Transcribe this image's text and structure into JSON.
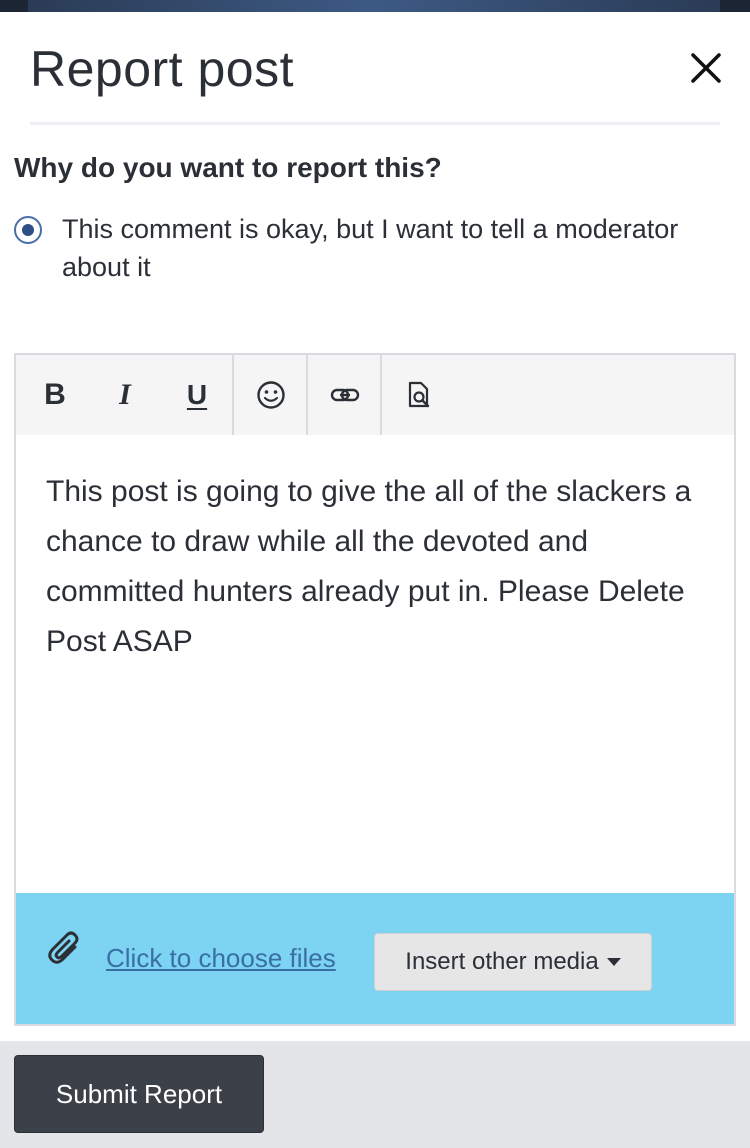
{
  "dialog": {
    "title": "Report post",
    "close_icon": "close-icon"
  },
  "question": "Why do you want to report this?",
  "reason_option": {
    "label": "This comment is okay, but I want to tell a moderator about it",
    "selected": true
  },
  "toolbar": {
    "bold_label": "B",
    "italic_label": "I",
    "underline_label": "U",
    "icons": [
      "emoji-icon",
      "link-icon",
      "preview-icon"
    ]
  },
  "editor": {
    "text": "This post is going to give the all of the slackers a chance to draw while all the devoted and committed hunters already put in. Please Delete Post ASAP"
  },
  "attachments": {
    "choose_files_label": "Click to choose files",
    "insert_media_label": "Insert other media",
    "background_color": "#7dd4f2"
  },
  "footer": {
    "submit_label": "Submit Report"
  }
}
